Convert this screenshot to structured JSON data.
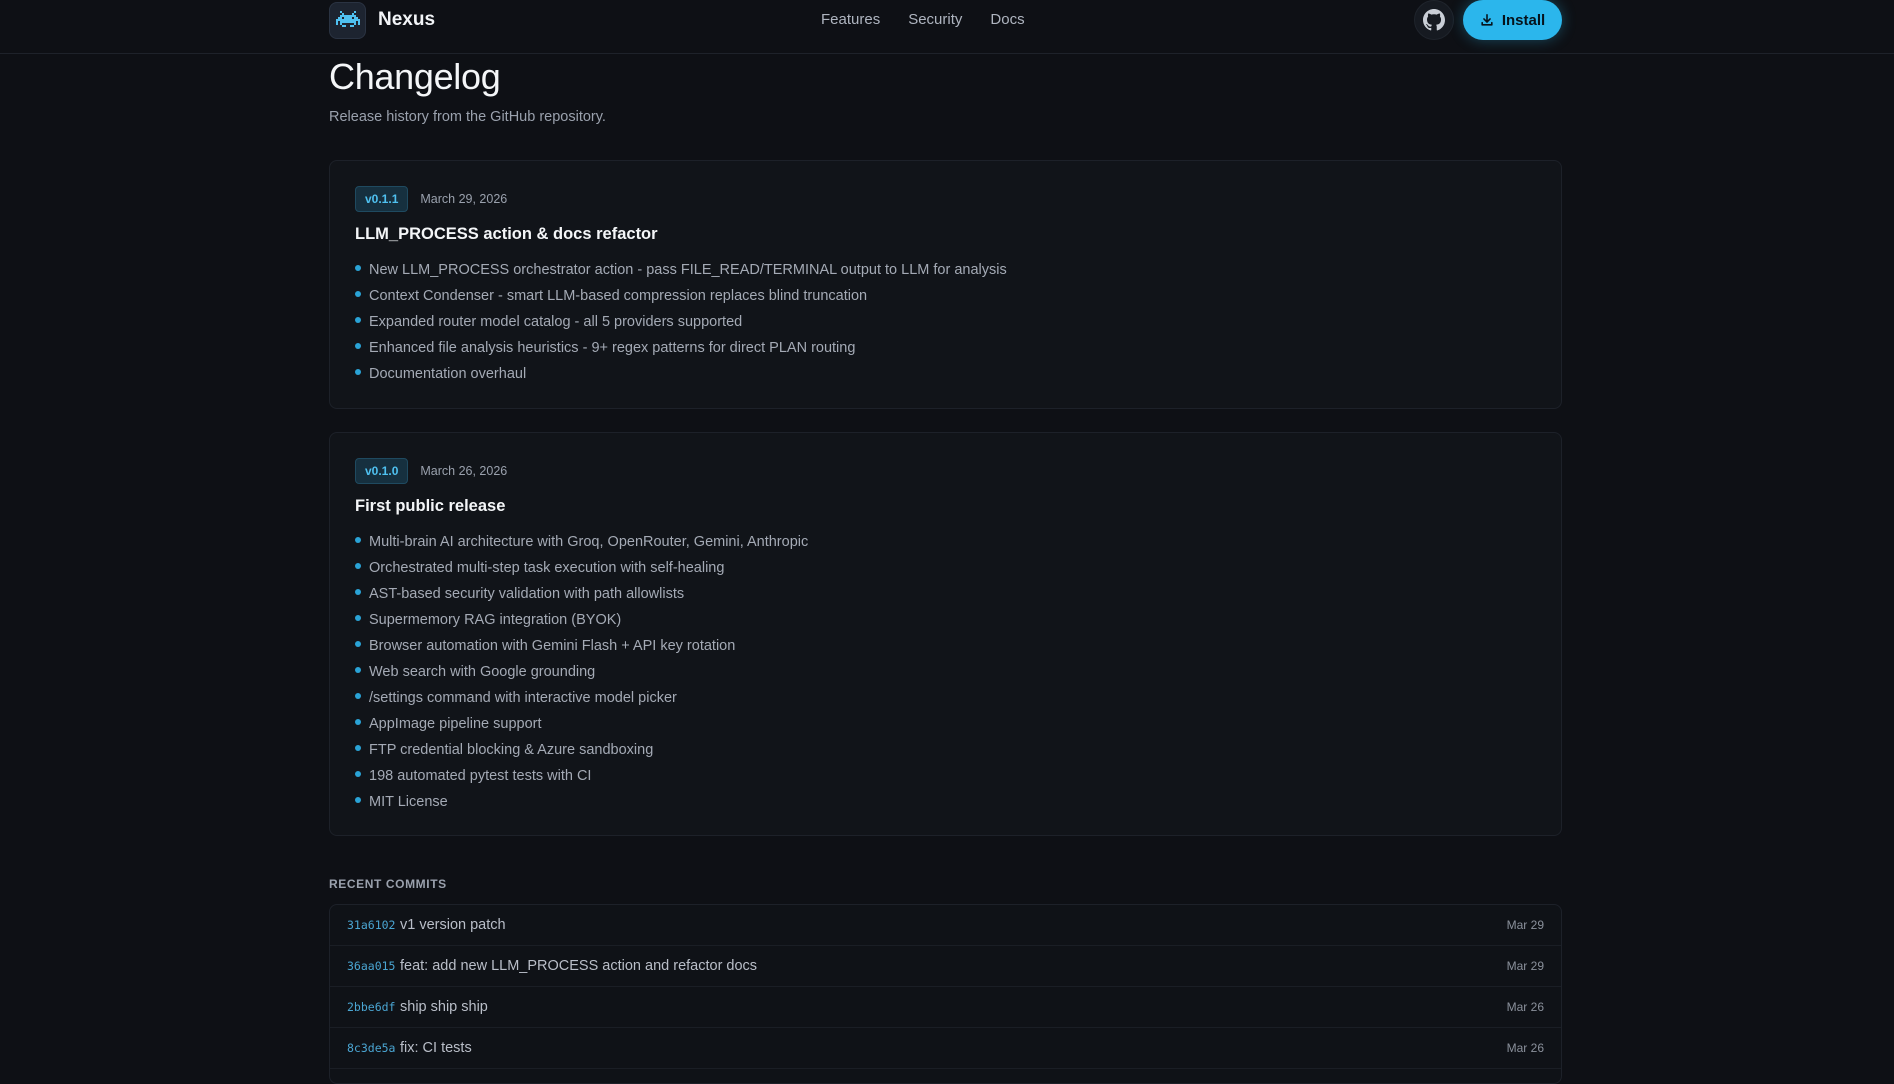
{
  "header": {
    "brand": "Nexus",
    "nav": [
      "Features",
      "Security",
      "Docs"
    ],
    "install_label": "Install"
  },
  "page": {
    "title": "Changelog",
    "subtitle": "Release history from the GitHub repository."
  },
  "releases": [
    {
      "version": "v0.1.1",
      "date": "March 29, 2026",
      "title": "LLM_PROCESS action & docs refactor",
      "items": [
        "New LLM_PROCESS orchestrator action - pass FILE_READ/TERMINAL output to LLM for analysis",
        "Context Condenser - smart LLM-based compression replaces blind truncation",
        "Expanded router model catalog - all 5 providers supported",
        "Enhanced file analysis heuristics - 9+ regex patterns for direct PLAN routing",
        "Documentation overhaul"
      ]
    },
    {
      "version": "v0.1.0",
      "date": "March 26, 2026",
      "title": "First public release",
      "items": [
        "Multi-brain AI architecture with Groq, OpenRouter, Gemini, Anthropic",
        "Orchestrated multi-step task execution with self-healing",
        "AST-based security validation with path allowlists",
        "Supermemory RAG integration (BYOK)",
        "Browser automation with Gemini Flash + API key rotation",
        "Web search with Google grounding",
        "/settings command with interactive model picker",
        "AppImage pipeline support",
        "FTP credential blocking & Azure sandboxing",
        "198 automated pytest tests with CI",
        "MIT License"
      ]
    }
  ],
  "commits_section": {
    "label": "RECENT COMMITS",
    "rows": [
      {
        "sha": "31a6102",
        "message": "v1 version patch",
        "date": "Mar 29"
      },
      {
        "sha": "36aa015",
        "message": "feat: add new LLM_PROCESS action and refactor docs",
        "date": "Mar 29"
      },
      {
        "sha": "2bbe6df",
        "message": "ship ship ship",
        "date": "Mar 26"
      },
      {
        "sha": "8c3de5a",
        "message": "fix: CI tests",
        "date": "Mar 26"
      }
    ]
  },
  "colors": {
    "accent": "#2bb6ec",
    "background": "#0e1015"
  }
}
